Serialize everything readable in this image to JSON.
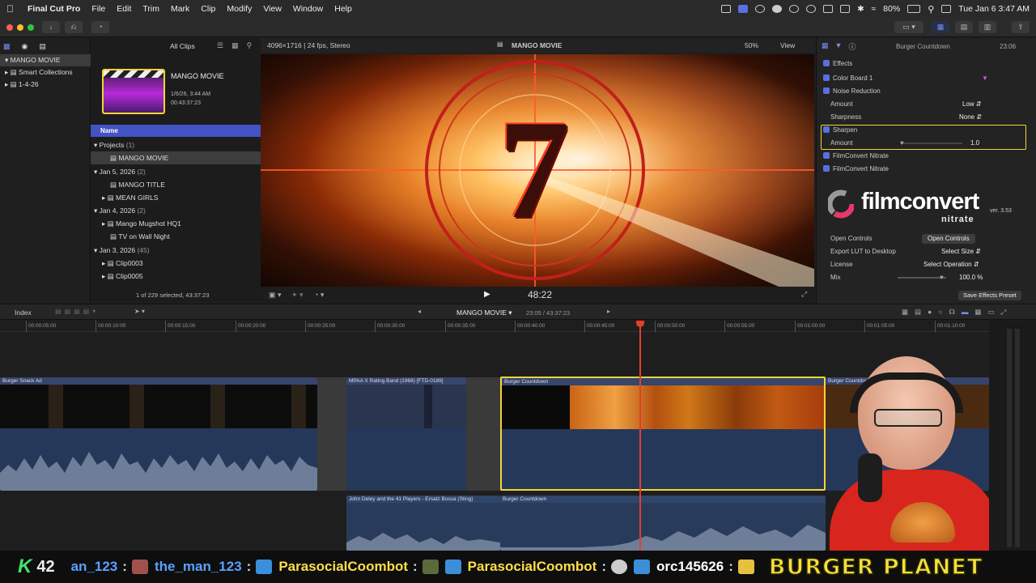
{
  "menubar": {
    "app": "Final Cut Pro",
    "menus": [
      "File",
      "Edit",
      "Trim",
      "Mark",
      "Clip",
      "Modify",
      "View",
      "Window",
      "Help"
    ],
    "battery": "80%",
    "datetime": "Tue Jan 6  3:47 AM"
  },
  "toolbar": {
    "icons": [
      "import-icon",
      "keywords-icon",
      "background-tasks-icon"
    ]
  },
  "library": {
    "root": "MANGO MOVIE",
    "items": [
      "Smart Collections",
      "1-4-26"
    ]
  },
  "browser": {
    "filter": "All Clips",
    "project": {
      "title": "MANGO MOVIE",
      "date": "1/6/26, 3:44 AM",
      "duration": "00:43:37:23"
    },
    "column_header": "Name",
    "rows": [
      {
        "label": "Projects",
        "count": "(1)",
        "type": "group"
      },
      {
        "label": "MANGO MOVIE",
        "count": "",
        "type": "item",
        "selected": true
      },
      {
        "label": "Jan 5, 2026",
        "count": "(2)",
        "type": "group"
      },
      {
        "label": "MANGO TITLE",
        "count": "",
        "type": "item"
      },
      {
        "label": "MEAN GIRLS",
        "count": "",
        "type": "item"
      },
      {
        "label": "Jan 4, 2026",
        "count": "(2)",
        "type": "group"
      },
      {
        "label": "Mango Mugshot HQ1",
        "count": "",
        "type": "item"
      },
      {
        "label": "TV on Wall Night",
        "count": "",
        "type": "item"
      },
      {
        "label": "Jan 3, 2026",
        "count": "(45)",
        "type": "group"
      },
      {
        "label": "Clip0003",
        "count": "",
        "type": "item"
      },
      {
        "label": "Clip0005",
        "count": "",
        "type": "item"
      }
    ],
    "status": "1 of 229 selected, 43:37:23"
  },
  "viewer": {
    "format": "4096×1716 | 24 fps, Stereo",
    "title": "MANGO MOVIE",
    "zoom": "50%",
    "view_label": "View",
    "countdown_number": "7",
    "timecode": "48:22"
  },
  "inspector": {
    "clip_name": "Burger Countdown",
    "duration": "23:06",
    "section": "Effects",
    "effects": [
      {
        "name": "Color Board 1"
      },
      {
        "name": "Noise Reduction",
        "params": [
          {
            "label": "Amount",
            "value": "Low"
          },
          {
            "label": "Sharpness",
            "value": "None"
          }
        ]
      },
      {
        "name": "Sharpen",
        "params": [
          {
            "label": "Amount",
            "value": "1.0"
          }
        ]
      },
      {
        "name": "FilmConvert Nitrate"
      },
      {
        "name": "FilmConvert Nitrate"
      }
    ],
    "filmconvert": {
      "brand": "filmconvert",
      "sub": "nitrate",
      "version": "ver. 3.53"
    },
    "controls": [
      {
        "label": "Open Controls",
        "value": "Open Controls"
      },
      {
        "label": "Export LUT to Desktop",
        "value": "Select Size"
      },
      {
        "label": "License",
        "value": "Select Operation"
      },
      {
        "label": "Mix",
        "value": "100.0 %"
      }
    ],
    "save_preset": "Save Effects Preset"
  },
  "timeline": {
    "index_label": "Index",
    "project": "MANGO MOVIE",
    "position": "23:05 / 43:37:23",
    "ruler": [
      "00:00:05:00",
      "00:00:10:00",
      "00:00:15:00",
      "00:00:20:00",
      "00:00:25:00",
      "00:00:30:00",
      "00:00:35:00",
      "00:00:40:00",
      "00:00:45:00",
      "00:00:50:00",
      "00:00:55:00",
      "00:01:00:00",
      "00:01:05:00",
      "00:01:10:00"
    ],
    "clips": [
      {
        "name": "Burger Snack Ad"
      },
      {
        "name": "MPAA X Rating Band (1968) [FTD-0189]"
      },
      {
        "name": "Burger Countdown"
      },
      {
        "name": "Burger Countdown"
      }
    ],
    "audio_clips": [
      {
        "name": "John Deley and the 41 Players - Ersatz Bossa (Sting)"
      },
      {
        "name": "Burger Countdown"
      }
    ],
    "colors": {
      "selection": "#f3d534",
      "playhead": "#e0402a",
      "clip_bar": "#36456a",
      "audio": "#293b5a"
    }
  },
  "chat": {
    "points_icon": "K",
    "points": "42",
    "entries": [
      {
        "user": "an_123",
        "color": "#5aa0ff"
      },
      {
        "user": "the_man_123",
        "color": "#5aa0ff"
      },
      {
        "user": "ParasocialCoombot",
        "color": "#ffde4a"
      },
      {
        "user": "ParasocialCoombot",
        "color": "#ffde4a"
      },
      {
        "user": "orc145626",
        "color": "#ffffff"
      }
    ],
    "banner": "BURGER PLANET"
  }
}
